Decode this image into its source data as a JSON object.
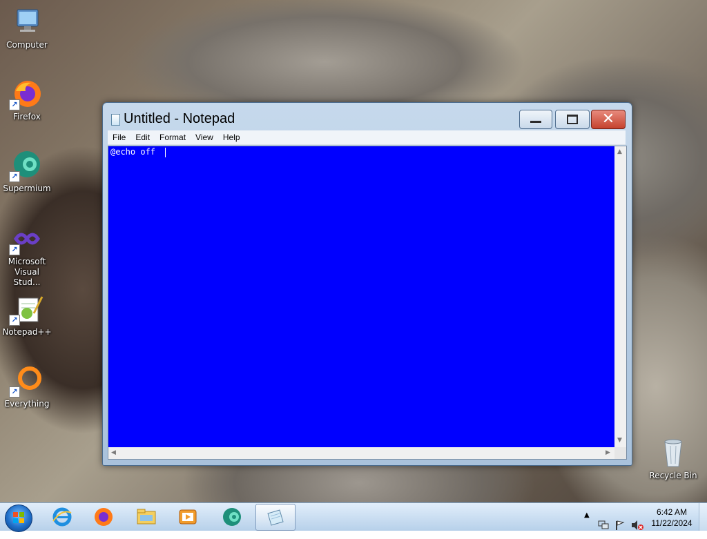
{
  "desktop": {
    "icons": [
      {
        "label": "Computer",
        "icon": "computer-icon"
      },
      {
        "label": "Firefox",
        "icon": "firefox-icon"
      },
      {
        "label": "Supermium",
        "icon": "supermium-icon"
      },
      {
        "label": "Microsoft Visual Stud...",
        "icon": "visual-studio-icon"
      },
      {
        "label": "Notepad++",
        "icon": "notepadpp-icon"
      },
      {
        "label": "Everything",
        "icon": "everything-icon"
      },
      {
        "label": "Recycle Bin",
        "icon": "recycle-bin-icon"
      }
    ]
  },
  "window": {
    "title": "Untitled - Notepad",
    "menu": [
      "File",
      "Edit",
      "Format",
      "View",
      "Help"
    ],
    "content": "@echo off ",
    "editor_bg": "#0000ff",
    "editor_fg": "#ffffff"
  },
  "taskbar": {
    "pinned": [
      "start-orb",
      "internet-explorer-icon",
      "firefox-icon",
      "file-explorer-icon",
      "media-player-icon",
      "supermium-icon",
      "notepad-icon"
    ],
    "clock_time": "6:42 AM",
    "clock_date": "11/22/2024",
    "tray_icons": [
      "show-hidden-icons-arrow",
      "network-icon",
      "action-center-flag-icon",
      "volume-muted-icon"
    ]
  }
}
